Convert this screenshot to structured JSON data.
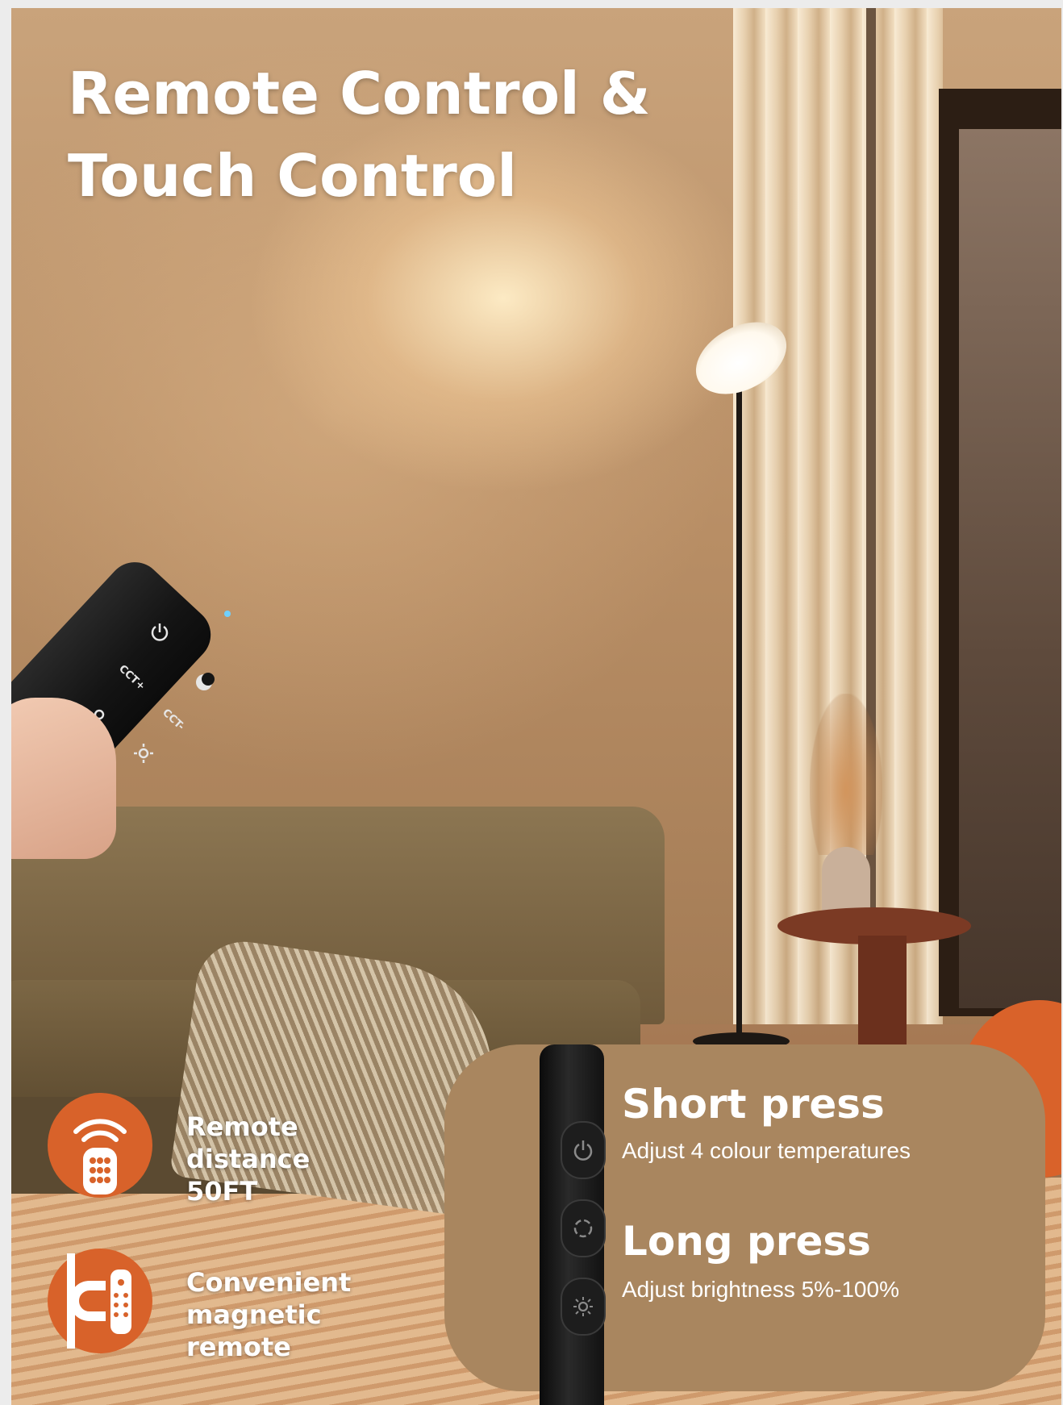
{
  "headline": {
    "line1": "Remote Control &",
    "line2": "Touch Control"
  },
  "features": [
    {
      "icon": "remote-wifi-icon",
      "line1": "Remote distance",
      "line2": "50FT"
    },
    {
      "icon": "magnet-remote-icon",
      "line1": "Convenient",
      "line2": "magnetic remote"
    }
  ],
  "remote": {
    "buttons": [
      "power",
      "CCT+",
      "night-mode",
      "brightness-up",
      "CCT-",
      "brightness-down"
    ],
    "cct_plus": "CCT+",
    "cct_minus": "CCT-"
  },
  "touch_panel": {
    "short_press": {
      "title": "Short press",
      "desc": "Adjust 4 colour temperatures"
    },
    "long_press": {
      "title": "Long press",
      "desc": "Adjust brightness 5%-100%"
    },
    "buttons": [
      "power-icon",
      "cycle-icon",
      "brightness-icon"
    ]
  },
  "colors": {
    "accent": "#d8622a",
    "panel": "#a9865f",
    "text": "#ffffff"
  }
}
